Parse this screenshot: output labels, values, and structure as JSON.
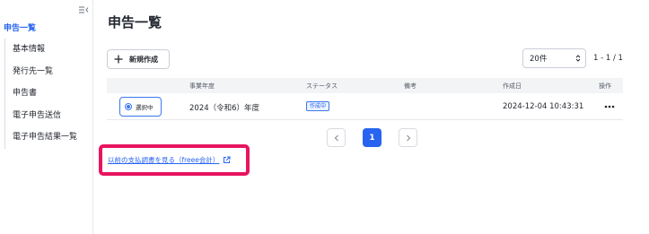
{
  "sidebar": {
    "parent_label": "申告一覧",
    "items": [
      {
        "label": "基本情報"
      },
      {
        "label": "発行先一覧"
      },
      {
        "label": "申告書"
      },
      {
        "label": "電子申告送信"
      },
      {
        "label": "電子申告結果一覧"
      }
    ]
  },
  "main": {
    "title": "申告一覧",
    "new_button_label": "新規作成",
    "per_page": "20件",
    "range": "1 - 1 / 1",
    "table": {
      "headers": {
        "year": "事業年度",
        "status": "ステータス",
        "note": "備考",
        "created": "作成日",
        "action": "操作"
      },
      "rows": [
        {
          "selected_label": "選択中",
          "year": "2024（令和6）年度",
          "status": "作成中",
          "note": "",
          "created": "2024-12-04 10:43:31"
        }
      ]
    },
    "pagination": {
      "current": "1"
    },
    "history_link": "以前の支払調書を見る（freee会計）"
  },
  "colors": {
    "accent": "#2864f0",
    "highlight": "#e8145f",
    "header_bg": "#f3f4f6"
  },
  "icons": [
    "sidebar-collapse-icon",
    "plus-icon",
    "select-arrows-icon",
    "more-icon",
    "chevron-left-icon",
    "chevron-right-icon",
    "external-link-icon"
  ]
}
